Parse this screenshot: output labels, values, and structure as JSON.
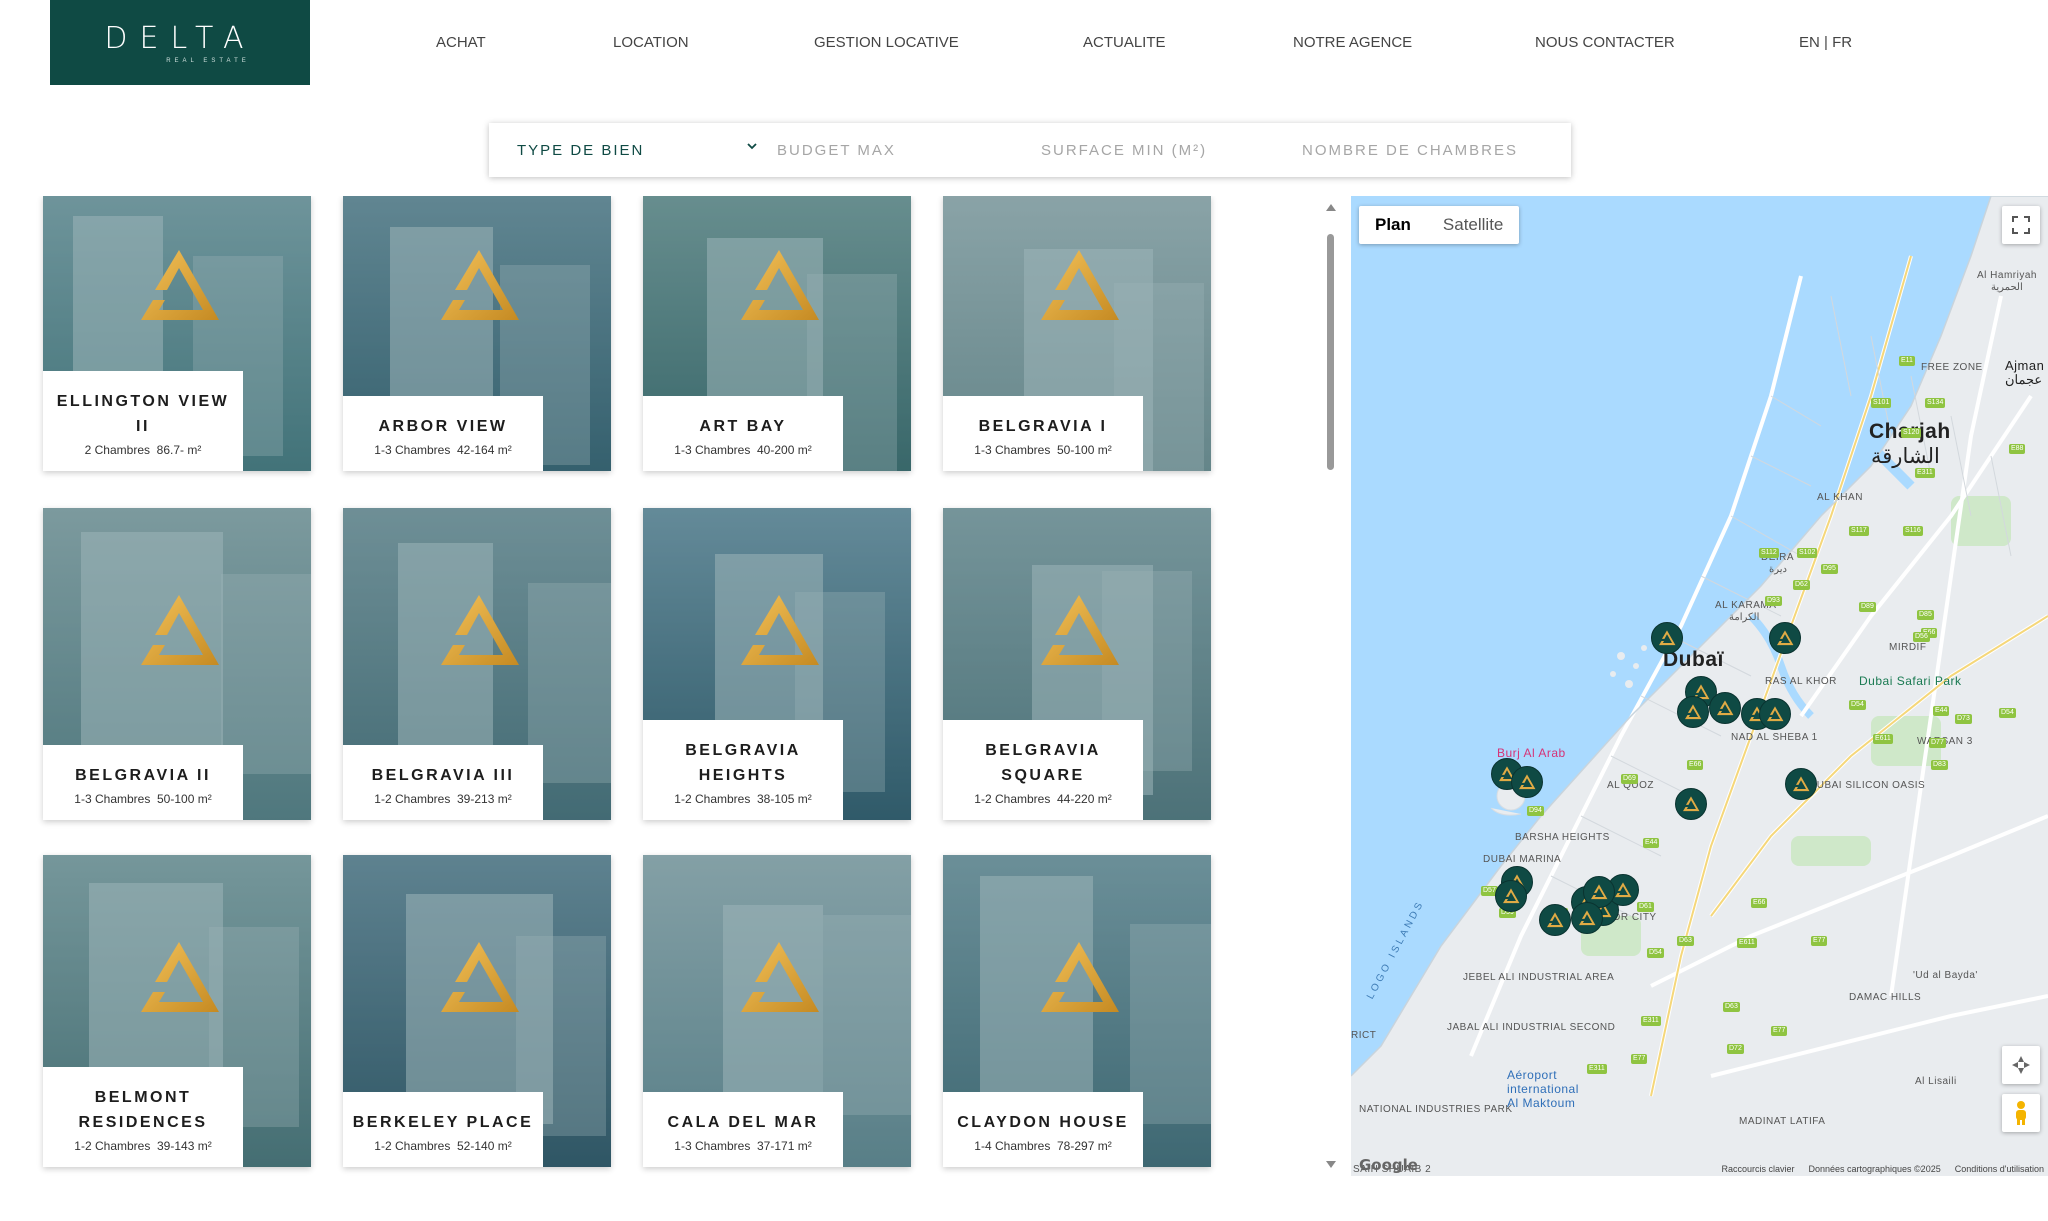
{
  "header": {
    "logo_text": "DELTA",
    "logo_sub": "REAL ESTATE",
    "nav": [
      "ACHAT",
      "LOCATION",
      "GESTION LOCATIVE",
      "ACTUALITE",
      "NOTRE AGENCE",
      "NOUS CONTACTER"
    ],
    "lang_en": "EN",
    "lang_sep": " | ",
    "lang_fr": "FR"
  },
  "search": {
    "type_label": "TYPE DE BIEN",
    "budget_placeholder": "BUDGET MAX",
    "surface_placeholder": "SURFACE MIN (M²)",
    "rooms_placeholder": "NOMBRE DE CHAMBRES"
  },
  "listings": [
    {
      "name": "ELLINGTON VIEW II",
      "rooms": "2 Chambres",
      "area": "86.7- m²"
    },
    {
      "name": "ARBOR VIEW",
      "rooms": "1-3 Chambres",
      "area": "42-164 m²"
    },
    {
      "name": "ART BAY",
      "rooms": "1-3 Chambres",
      "area": "40-200 m²"
    },
    {
      "name": "BELGRAVIA I",
      "rooms": "1-3 Chambres",
      "area": "50-100 m²"
    },
    {
      "name": "BELGRAVIA II",
      "rooms": "1-3 Chambres",
      "area": "50-100 m²"
    },
    {
      "name": "BELGRAVIA III",
      "rooms": "1-2 Chambres",
      "area": "39-213 m²"
    },
    {
      "name": "BELGRAVIA HEIGHTS",
      "rooms": "1-2 Chambres",
      "area": "38-105 m²"
    },
    {
      "name": "BELGRAVIA SQUARE",
      "rooms": "1-2 Chambres",
      "area": "44-220 m²"
    },
    {
      "name": "BELMONT RESIDENCES",
      "rooms": "1-2 Chambres",
      "area": "39-143 m²"
    },
    {
      "name": "BERKELEY PLACE",
      "rooms": "1-2 Chambres",
      "area": "52-140 m²"
    },
    {
      "name": "CALA DEL MAR",
      "rooms": "1-3 Chambres",
      "area": "37-171 m²"
    },
    {
      "name": "CLAYDON HOUSE",
      "rooms": "1-4 Chambres",
      "area": "78-297 m²"
    }
  ],
  "map": {
    "plan_label": "Plan",
    "satellite_label": "Satellite",
    "labels": {
      "dubai": "Dubaï",
      "sharjah": "Charjah",
      "sharjah_ar": "الشارقة",
      "ajman": "Ajman",
      "ajman_ar": "عجمان",
      "hamriyah": "Al Hamriyah",
      "hamriyah_ar": "الحمرية",
      "free_zone": "FREE ZONE",
      "al_khan": "AL KHAN",
      "deira": "DEIRA",
      "deira_ar": "ديرة",
      "al_karama": "AL KARAMA",
      "al_karama_ar": "الكرامة",
      "mirdif": "MIRDIF",
      "ras_al_khor": "RAS AL KHOR",
      "nad_al_sheba": "NAD AL SHEBA 1",
      "al_quoz": "AL QUOZ",
      "barsha_heights": "BARSHA HEIGHTS",
      "dubai_marina": "DUBAI MARINA",
      "motor_city": "MOTOR CITY",
      "jebel_ali": "JEBEL ALI INDUSTRIAL AREA",
      "jabal_ali_second": "JABAL ALI INDUSTRIAL SECOND",
      "national_park": "NATIONAL INDUSTRIES PARK",
      "dubai_silicon": "DUBAI SILICON OASIS",
      "warsan": "WARSAN 3",
      "ud_al_bayda": "'Ud al Bayda'",
      "damac_hills": "DAMAC HILLS",
      "al_lisaili": "Al Lisaili",
      "madinat_latifa": "MADINAT LATIFA",
      "safari_park": "Dubai Safari Park",
      "burj_al_arab": "Burj Al Arab",
      "airport_1": "Aéroport",
      "airport_2": "international",
      "airport_3": "Al Maktoum",
      "logo_islands": "LOGO ISLANDS",
      "rict": "RICT",
      "saih_shuaib": "SAIH SHUAIB 2"
    },
    "roads": [
      "E11",
      "S101",
      "S134",
      "S120",
      "E311",
      "E88",
      "S117",
      "S116",
      "S112",
      "S102",
      "D95",
      "D93",
      "D62",
      "D85",
      "D89",
      "E66",
      "D56",
      "D54",
      "E44",
      "D73",
      "E611",
      "D77",
      "D54",
      "D83",
      "D94",
      "E44",
      "D63",
      "D69",
      "E66",
      "D57",
      "D59",
      "D72",
      "D61",
      "E311",
      "D63",
      "D54",
      "E611",
      "E66",
      "E77",
      "D63",
      "E77",
      "D72",
      "E77",
      "E311"
    ],
    "footer": [
      "Raccourcis clavier",
      "Données cartographiques ©2025",
      "Conditions d'utilisation"
    ],
    "google": "Google"
  },
  "colors": {
    "brand": "#0f4a44",
    "gold": "#d9a23a",
    "water": "#aadaff",
    "land": "#e8ebee"
  }
}
